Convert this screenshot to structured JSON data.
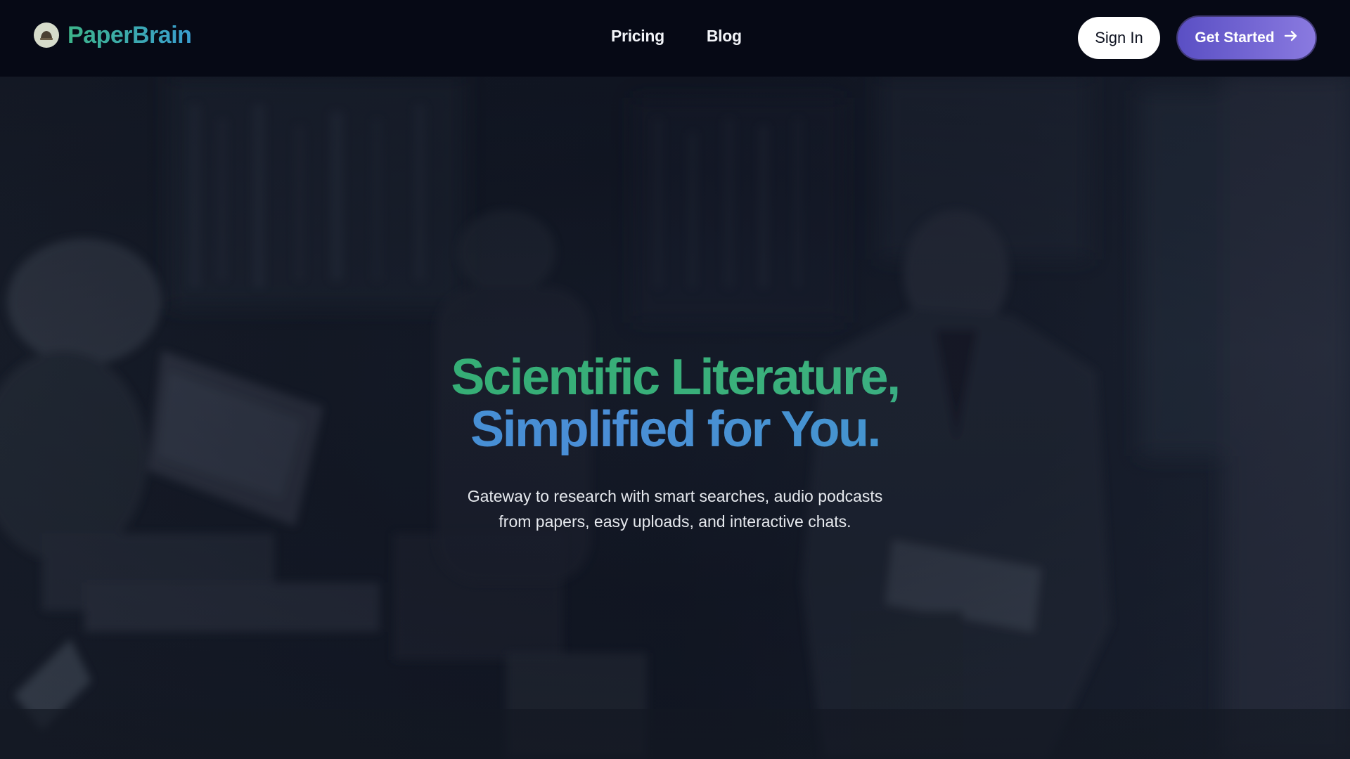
{
  "header": {
    "logo_text": "PaperBrain",
    "nav": [
      {
        "label": "Pricing"
      },
      {
        "label": "Blog"
      }
    ],
    "sign_in_label": "Sign In",
    "get_started_label": "Get Started"
  },
  "hero": {
    "headline_line1": "Scientific Literature,",
    "headline_line2": "Simplified for You.",
    "subtitle": "Gateway to research with smart searches, audio podcasts from papers, easy uploads, and interactive chats."
  },
  "icons": {
    "logo": "logo-icon",
    "arrow": "arrow-right-icon"
  },
  "colors": {
    "header_bg": "#060915",
    "brand_green": "#3db48a",
    "brand_blue": "#3a9ed0",
    "cta_purple": "#6f62d2"
  }
}
